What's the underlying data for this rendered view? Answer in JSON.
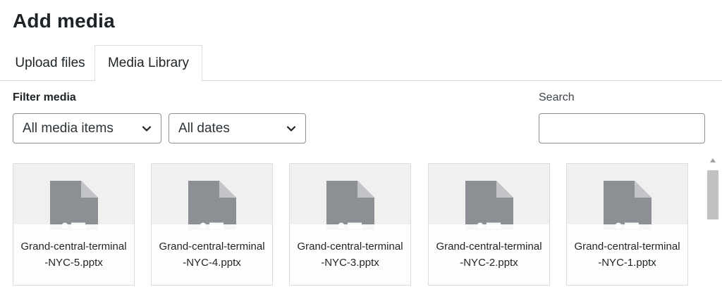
{
  "page": {
    "title": "Add media"
  },
  "tabs": [
    {
      "label": "Upload files",
      "active": false
    },
    {
      "label": "Media Library",
      "active": true
    }
  ],
  "filters": {
    "label": "Filter media",
    "media_type": {
      "selected": "All media items",
      "icon": "chevron-down-icon"
    },
    "dates": {
      "selected": "All dates",
      "icon": "chevron-down-icon"
    }
  },
  "search": {
    "label": "Search",
    "value": ""
  },
  "media_items": [
    {
      "filename": "Grand-central-terminal-NYC-5.pptx",
      "icon": "presentation-file-icon"
    },
    {
      "filename": "Grand-central-terminal-NYC-4.pptx",
      "icon": "presentation-file-icon"
    },
    {
      "filename": "Grand-central-terminal-NYC-3.pptx",
      "icon": "presentation-file-icon"
    },
    {
      "filename": "Grand-central-terminal-NYC-2.pptx",
      "icon": "presentation-file-icon"
    },
    {
      "filename": "Grand-central-terminal-NYC-1.pptx",
      "icon": "presentation-file-icon"
    }
  ],
  "colors": {
    "text": "#1d2327",
    "border": "#8c8f94",
    "divider": "#dcdcde",
    "thumb_bg": "#f0f0f1",
    "file_icon": "#8c8f94"
  }
}
